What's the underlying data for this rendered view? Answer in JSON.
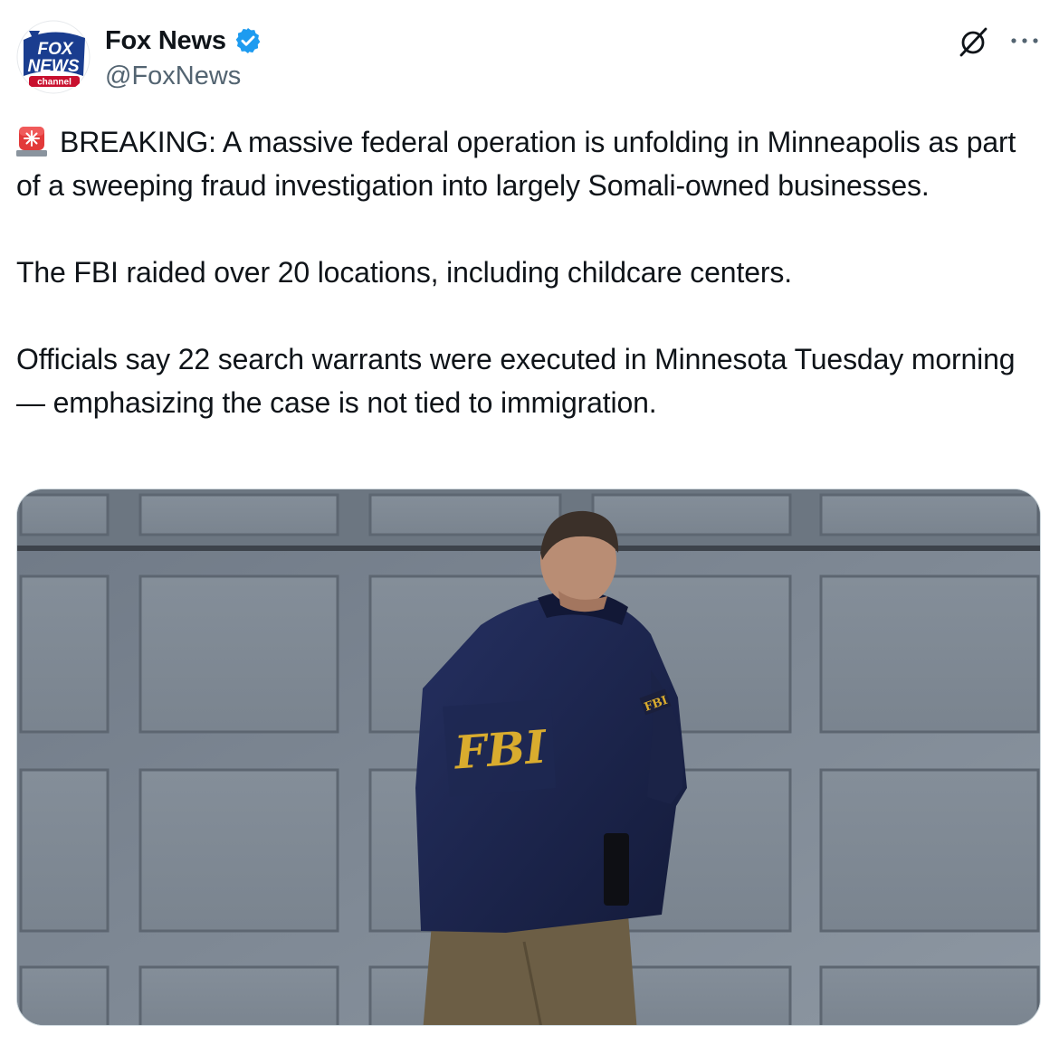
{
  "author": {
    "display_name": "Fox News",
    "handle": "@FoxNews",
    "verified": true,
    "verified_color": "#1d9bf0",
    "avatar": {
      "icon": "fox-news-channel-logo",
      "lines": [
        "FOX",
        "NEWS",
        "channel"
      ]
    }
  },
  "actions": {
    "grok_icon": "grok-icon",
    "more_icon": "more-options-icon"
  },
  "tweet": {
    "siren_icon": "rotating-light-emoji",
    "paragraphs": [
      "BREAKING: A massive federal operation is unfolding in Minneapolis as part of a sweeping fraud investigation into largely Somali-owned businesses.",
      "The FBI raided over 20 locations, including childcare centers.",
      "Officials say 22 search warrants were executed in Minnesota Tuesday morning — emphasizing the case is not tied to immigration."
    ]
  },
  "media": {
    "type": "photo",
    "jacket_text": "FBI",
    "sleeve_patch_text": "FBI"
  },
  "colors": {
    "text": "#0f1419",
    "secondary": "#536471",
    "border": "#cfd9de",
    "fox_blue": "#1a3d8f",
    "fox_red": "#c8102e"
  }
}
